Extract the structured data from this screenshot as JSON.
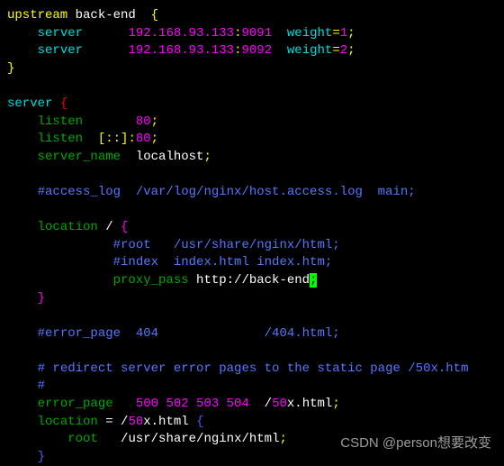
{
  "code": {
    "upstream_kw": "upstream",
    "upstream_name": " back-end  ",
    "lbrace": "{",
    "rbrace": "}",
    "server_kw": "server",
    "ip": "192.168.93.133",
    "colon": ":",
    "port1": "9091",
    "port2": "9092",
    "weight_kw": "weight",
    "eq": "=",
    "w1": "1",
    "w2": "2",
    "semi": ";",
    "listen_kw": "listen",
    "port80": "80",
    "ipv6": "[::]:",
    "server_name_kw": "server_name",
    "localhost": "localhost",
    "access_log_c": "#access_log  /var/log/nginx/host.access.log  main;",
    "location_kw": "location",
    "slash": " / ",
    "root_c": "#root   /usr/share/nginx/html;",
    "index_c": "#index  index.html index.htm;",
    "proxy_pass_kw": "proxy_pass",
    "proxy_url": " http://back-end",
    "error_page_c": "#error_page  404              /404.html;",
    "redirect_c1": "# redirect server error pages to the static page /50x.htm",
    "redirect_c2": "#",
    "error_page_kw": "error_page",
    "err_codes": "500 502 503 504",
    "fifty": "50",
    "xhtml": "x.html",
    "location_eq": "location",
    "eq_slash": " = /",
    "fifty2": "50",
    "xhtml2": "x.html ",
    "root_kw": "root",
    "root_path": "/usr/share/nginx/html",
    "indent1": "    ",
    "indent2": "              ",
    "indent3": "        "
  },
  "watermark": "CSDN @person想要改变"
}
